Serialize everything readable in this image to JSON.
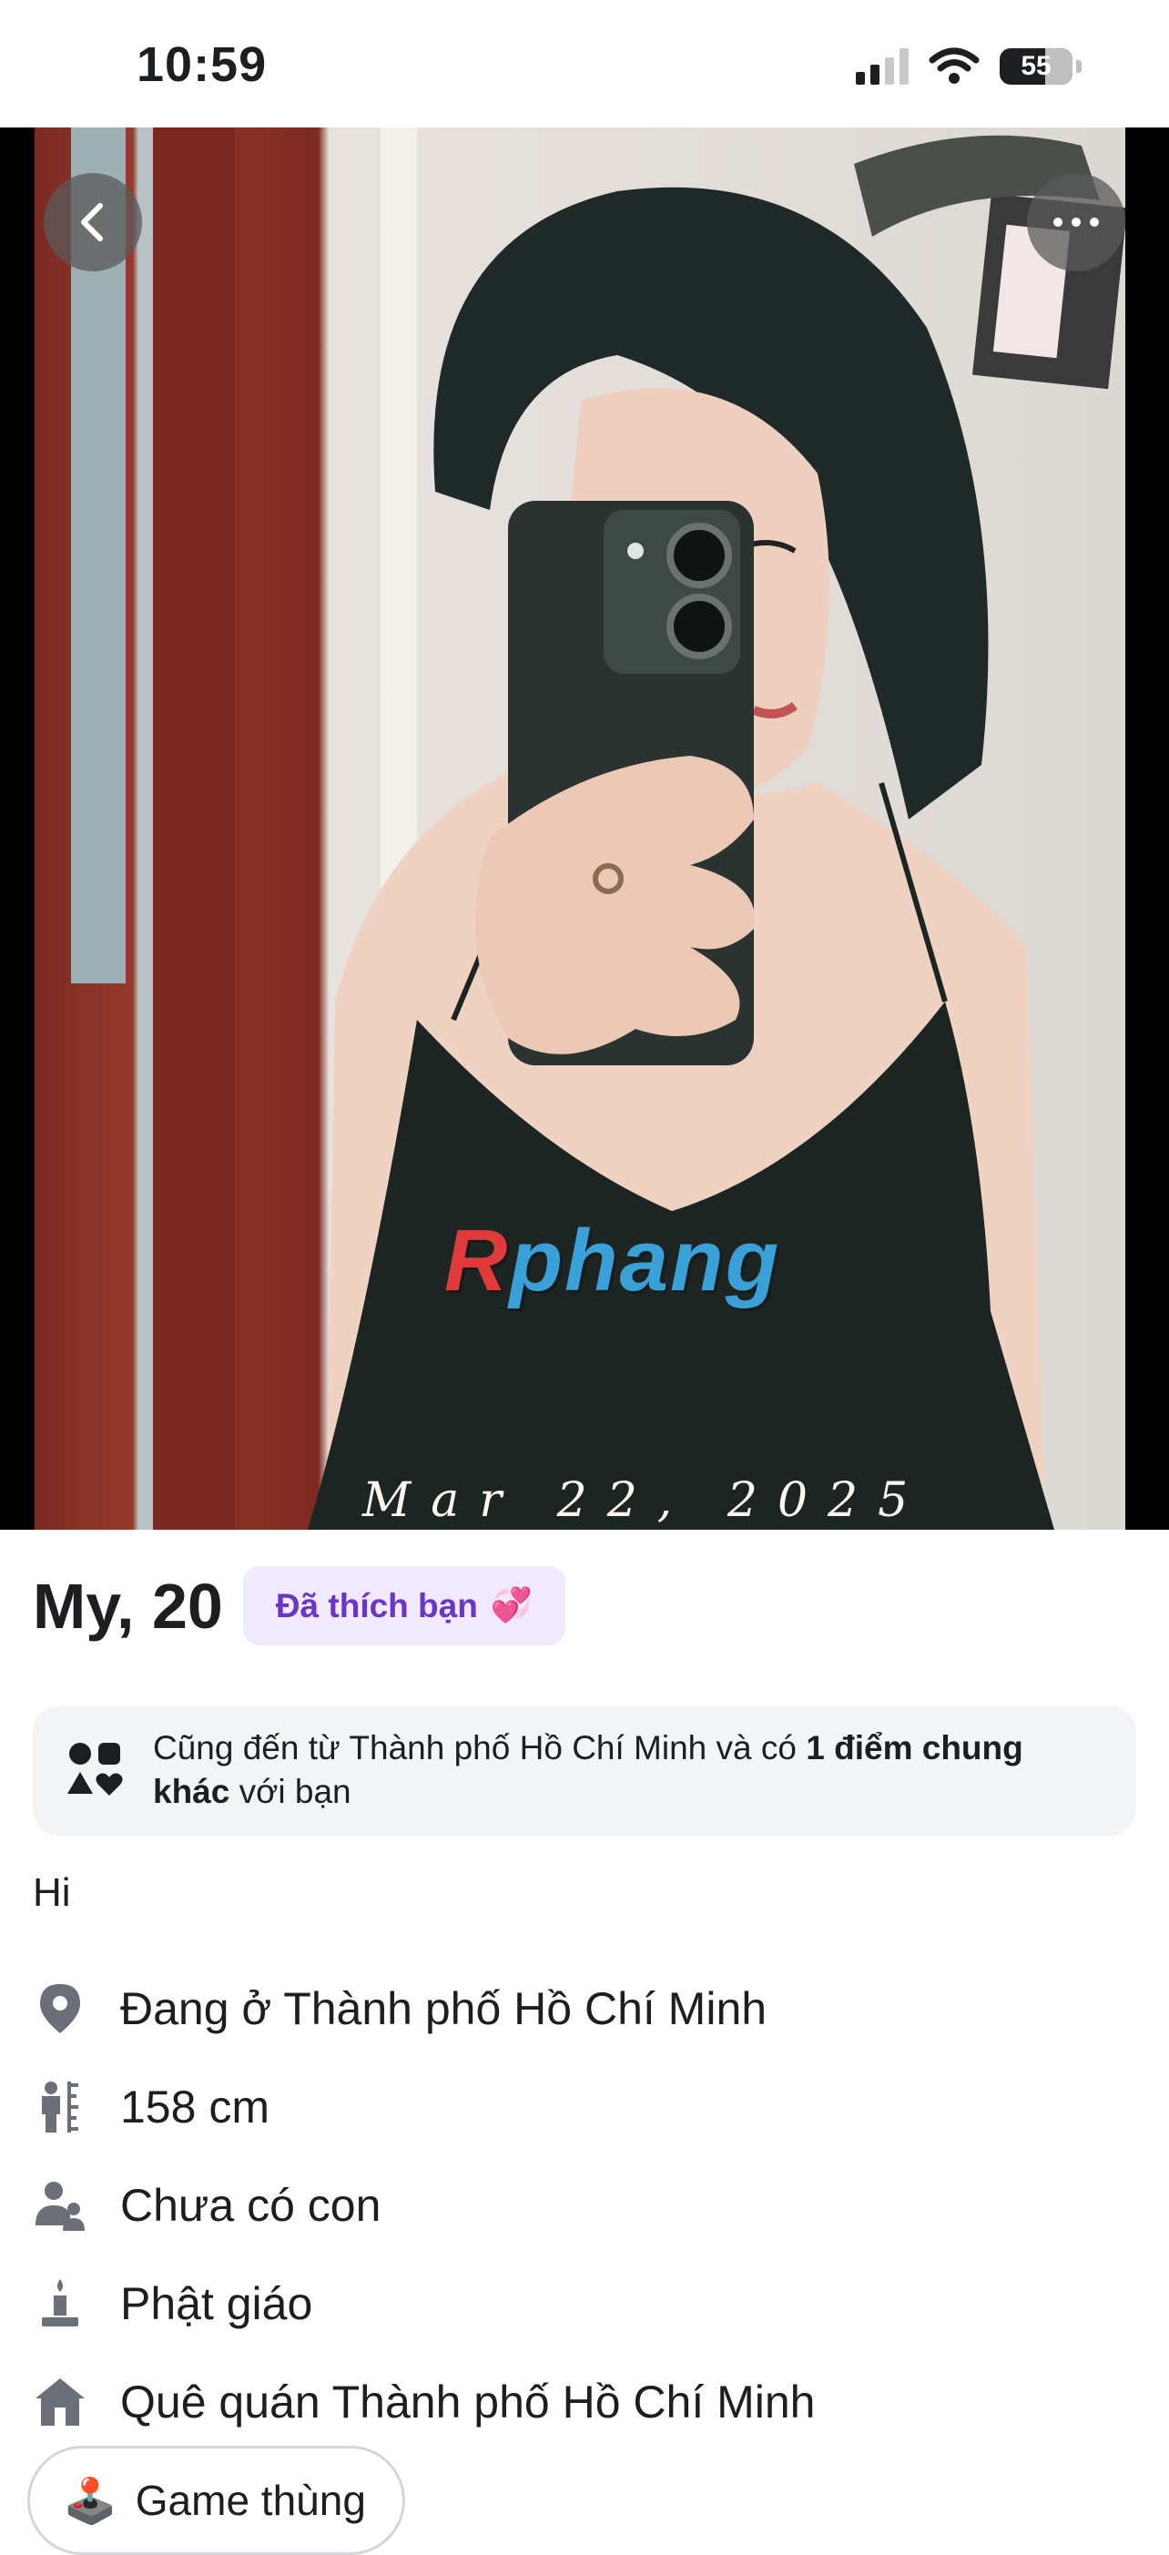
{
  "status_bar": {
    "time": "10:59",
    "battery": "55"
  },
  "photo": {
    "watermark": "Rphang",
    "date_stamp": "Mar 22, 2025"
  },
  "profile": {
    "name_age": "My, 20",
    "liked_badge": "Đã thích bạn",
    "liked_badge_emoji": "💞",
    "common": {
      "prefix": "Cũng đến từ Thành phố Hồ Chí Minh và có ",
      "bold_a": "1 điểm chung",
      "bold_b": "khác",
      "suffix": " với bạn"
    },
    "bio": "Hi",
    "details": [
      {
        "icon": "location-pin-icon",
        "text": "Đang ở Thành phố Hồ Chí Minh"
      },
      {
        "icon": "height-icon",
        "text": "158 cm"
      },
      {
        "icon": "children-icon",
        "text": "Chưa có con"
      },
      {
        "icon": "religion-icon",
        "text": "Phật giáo"
      },
      {
        "icon": "home-icon",
        "text": "Quê quán Thành phố Hồ Chí Minh"
      }
    ],
    "interest_chip": {
      "emoji": "🕹️",
      "label": "Game thùng"
    }
  },
  "colors": {
    "badge_bg": "#f1e9ff",
    "badge_text": "#6a35c9",
    "card_bg": "#f3f4f6",
    "icon": "#6b7078"
  }
}
